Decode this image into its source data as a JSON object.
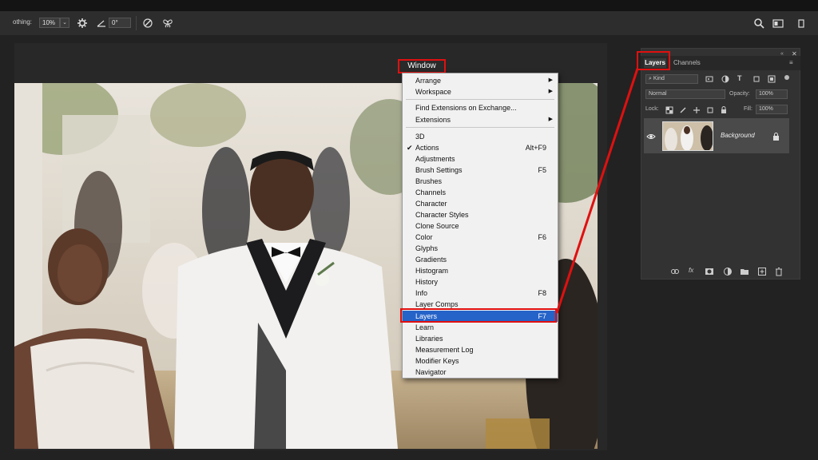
{
  "options_bar": {
    "smoothing_label": "othing:",
    "smoothing_value": "10%",
    "angle_value": "0°",
    "icons": [
      "settings-gear-icon",
      "angle-icon",
      "pressure-icon",
      "symmetry-butterfly-icon",
      "search-icon",
      "workspace-icon"
    ]
  },
  "menu_bar": {
    "window_label": "Window"
  },
  "window_menu": {
    "items": [
      {
        "label": "Arrange",
        "shortcut": "",
        "submenu": true
      },
      {
        "label": "Workspace",
        "shortcut": "",
        "submenu": true
      },
      {
        "label": "Find Extensions on Exchange...",
        "shortcut": "",
        "submenu": false
      },
      {
        "label": "Extensions",
        "shortcut": "",
        "submenu": true
      },
      {
        "label": "3D",
        "shortcut": ""
      },
      {
        "label": "Actions",
        "shortcut": "Alt+F9",
        "checked": true
      },
      {
        "label": "Adjustments",
        "shortcut": ""
      },
      {
        "label": "Brush Settings",
        "shortcut": "F5"
      },
      {
        "label": "Brushes",
        "shortcut": ""
      },
      {
        "label": "Channels",
        "shortcut": ""
      },
      {
        "label": "Character",
        "shortcut": ""
      },
      {
        "label": "Character Styles",
        "shortcut": ""
      },
      {
        "label": "Clone Source",
        "shortcut": ""
      },
      {
        "label": "Color",
        "shortcut": "F6"
      },
      {
        "label": "Glyphs",
        "shortcut": ""
      },
      {
        "label": "Gradients",
        "shortcut": ""
      },
      {
        "label": "Histogram",
        "shortcut": ""
      },
      {
        "label": "History",
        "shortcut": ""
      },
      {
        "label": "Info",
        "shortcut": "F8"
      },
      {
        "label": "Layer Comps",
        "shortcut": ""
      },
      {
        "label": "Layers",
        "shortcut": "F7",
        "selected": true
      },
      {
        "label": "Learn",
        "shortcut": ""
      },
      {
        "label": "Libraries",
        "shortcut": ""
      },
      {
        "label": "Measurement Log",
        "shortcut": ""
      },
      {
        "label": "Modifier Keys",
        "shortcut": ""
      },
      {
        "label": "Navigator",
        "shortcut": ""
      }
    ]
  },
  "layers_panel": {
    "tabs": [
      "Layers",
      "Channels"
    ],
    "kind_label": "Kind",
    "blend_mode": "Normal",
    "opacity_label": "Opacity:",
    "opacity_value": "100%",
    "lock_label": "Lock:",
    "fill_label": "Fill:",
    "fill_value": "100%",
    "layer_name": "Background"
  },
  "colors": {
    "highlight_red": "#e01010",
    "menu_selection": "#2563c8",
    "panel_bg": "#323232"
  }
}
